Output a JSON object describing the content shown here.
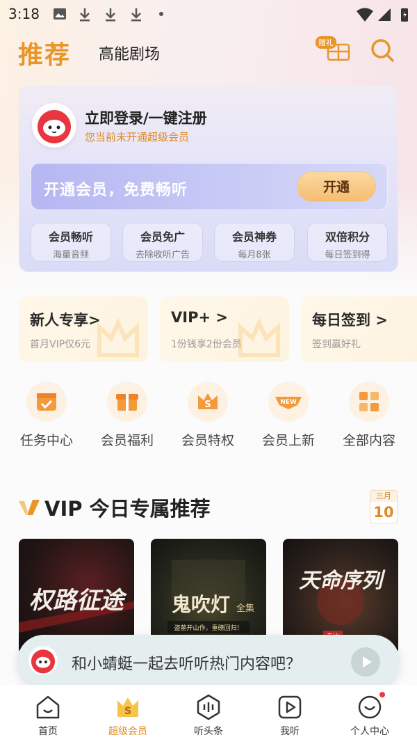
{
  "status_bar": {
    "time": "3:18"
  },
  "header": {
    "tab_main": "推荐",
    "tab_second": "高能剧场",
    "gift_badge": "赠礼"
  },
  "member_card": {
    "login_title": "立即登录/一键注册",
    "login_subtitle": "您当前未开通超级会员",
    "promo_text": "开通会员，免费畅听",
    "promo_button": "开通",
    "perks": [
      {
        "title": "会员畅听",
        "subtitle": "海量音频"
      },
      {
        "title": "会员免广",
        "subtitle": "去除收听广告"
      },
      {
        "title": "会员神券",
        "subtitle": "每月8张"
      },
      {
        "title": "双倍积分",
        "subtitle": "每日签到得"
      }
    ]
  },
  "quick_cards": [
    {
      "title": "新人专享>",
      "subtitle": "首月VIP仅6元"
    },
    {
      "title": "VIP+ >",
      "subtitle": "1份钱享2份会员"
    },
    {
      "title": "每日签到 >",
      "subtitle": "签到赢好礼"
    }
  ],
  "grid": [
    {
      "label": "任务中心",
      "icon": "calendar-check-icon"
    },
    {
      "label": "会员福利",
      "icon": "gift-box-icon"
    },
    {
      "label": "会员特权",
      "icon": "crown-s-icon"
    },
    {
      "label": "会员上新",
      "icon": "new-badge-icon"
    },
    {
      "label": "全部内容",
      "icon": "grid-squares-icon"
    }
  ],
  "section": {
    "title": "VIP 今日专属推荐",
    "calendar_month": "三月",
    "calendar_day": "10"
  },
  "posters": [
    {
      "text": "权路征途"
    },
    {
      "text": "鬼吹灯",
      "extra": "全集",
      "caption": "盗墓开山作，重磅回归！"
    },
    {
      "text": "天命序列",
      "tag": "专比"
    }
  ],
  "floating_bar": {
    "message": "和小蜻蜓一起去听听热门内容吧？"
  },
  "bottom_nav": [
    {
      "label": "首页"
    },
    {
      "label": "超级会员"
    },
    {
      "label": "听头条"
    },
    {
      "label": "我听"
    },
    {
      "label": "个人中心"
    }
  ],
  "colors": {
    "accent": "#e08a22",
    "card": "#e6e4f8"
  }
}
